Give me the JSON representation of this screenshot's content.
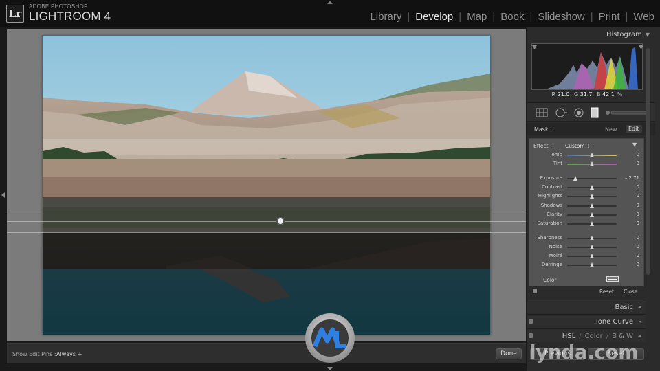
{
  "app": {
    "brand_small": "ADOBE PHOTOSHOP",
    "brand_big": "LIGHTROOM 4",
    "logo_text": "Lr"
  },
  "modules": [
    "Library",
    "Develop",
    "Map",
    "Book",
    "Slideshow",
    "Print",
    "Web"
  ],
  "active_module": "Develop",
  "panel": {
    "histogram_title": "Histogram",
    "readout": {
      "r_label": "R",
      "r": "21.0",
      "g_label": "G",
      "g": "31.7",
      "b_label": "B",
      "b": "42.1",
      "unit": "%"
    },
    "mask_label": "Mask :",
    "mask_new": "New",
    "mask_edit": "Edit",
    "effect_label": "Effect :",
    "effect_value": "Custom ÷",
    "sliders": [
      {
        "label": "Temp",
        "value": "0",
        "pos": 0.5,
        "track": "temp"
      },
      {
        "label": "Tint",
        "value": "0",
        "pos": 0.5,
        "track": "tint"
      },
      {
        "label": "Exposure",
        "value": "– 2.71",
        "pos": 0.18,
        "track": "plain"
      },
      {
        "label": "Contrast",
        "value": "0",
        "pos": 0.5,
        "track": "plain"
      },
      {
        "label": "Highlights",
        "value": "0",
        "pos": 0.5,
        "track": "plain"
      },
      {
        "label": "Shadows",
        "value": "0",
        "pos": 0.5,
        "track": "plain"
      },
      {
        "label": "Clarity",
        "value": "0",
        "pos": 0.5,
        "track": "plain"
      },
      {
        "label": "Saturation",
        "value": "0",
        "pos": 0.5,
        "track": "plain"
      },
      {
        "label": "Sharpness",
        "value": "0",
        "pos": 0.5,
        "track": "plain"
      },
      {
        "label": "Noise",
        "value": "0",
        "pos": 0.5,
        "track": "plain"
      },
      {
        "label": "Moiré",
        "value": "0",
        "pos": 0.5,
        "track": "plain"
      },
      {
        "label": "Defringe",
        "value": "0",
        "pos": 0.5,
        "track": "plain"
      }
    ],
    "color_label": "Color",
    "reset": "Reset",
    "close": "Close",
    "basic": "Basic",
    "tone_curve": "Tone Curve",
    "hsl": "HSL",
    "hsl_color": "Color",
    "hsl_bw": "B & W",
    "previous": "Previous",
    "reset_button": "Reset"
  },
  "toolbar": {
    "pins_label": "Show Edit Pins :",
    "pins_value": "Always ÷",
    "done": "Done"
  },
  "watermark": "lynda.com",
  "colors": {
    "accent_active": "#e6e6e6",
    "panel_bg": "#2b2b2b",
    "adjust_bg": "#545454"
  }
}
